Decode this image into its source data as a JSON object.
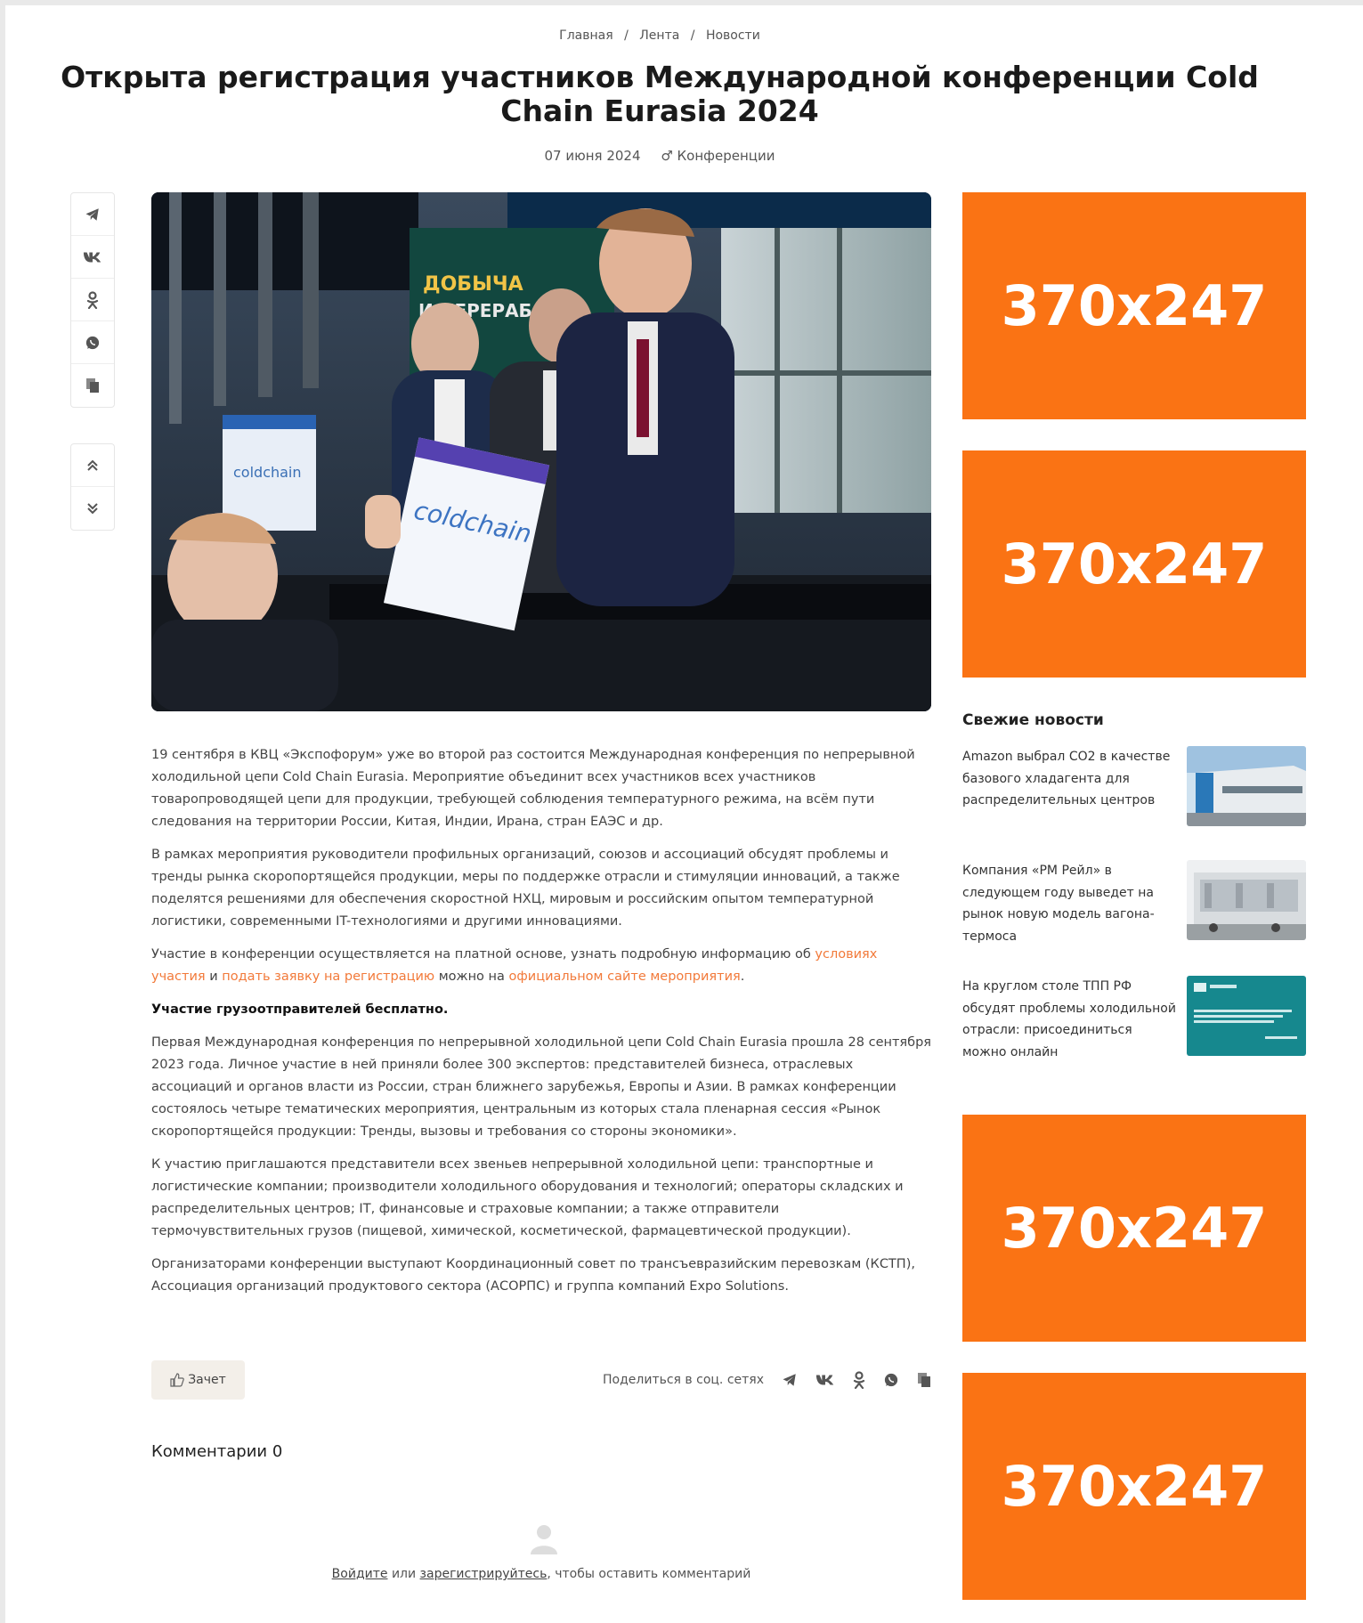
{
  "breadcrumb": {
    "home": "Главная",
    "feed": "Лента",
    "news": "Новости",
    "sep": "/"
  },
  "article": {
    "title": "Открыта регистрация участников Международной конференции Cold Chain Eurasia 2024",
    "date": "07 июня 2024",
    "category": "Конференции",
    "photo_texts": {
      "bag_label": "coldchain",
      "banner_line1": "ДОБЫЧА",
      "banner_line2": "И ПЕРЕРАБОТКА"
    },
    "p1": "19 сентября в КВЦ «Экспофорум» уже во второй раз состоится Международная конференция по непрерывной холодильной цепи Cold Chain Eurasia. Мероприятие объединит всех участников всех участников товаропроводящей цепи для продукции, требующей соблюдения температурного режима, на всём пути следования на территории России, Китая, Индии, Ирана, стран ЕАЭС и др.",
    "p2": "В рамках мероприятия руководители профильных организаций, союзов и ассоциаций обсудят проблемы и тренды рынка скоропортящейся продукции, меры по поддержке отрасли и стимуляции инноваций, а также поделятся решениями для обеспечения скоростной НХЦ, мировым и российским опытом температурной логистики, современными IT-технологиями и другими инновациями.",
    "p3_a": "Участие в конференции осуществляется на платной основе, узнать подробную информацию об ",
    "p3_link1": "условиях участия",
    "p3_b": " и ",
    "p3_link2": "подать заявку на регистрацию",
    "p3_c": " можно на ",
    "p3_link3": "официальном сайте мероприятия",
    "p3_d": ".",
    "p4_bold": "Участие грузоотправителей бесплатно.",
    "p5": "Первая Международная конференция по непрерывной холодильной цепи Cold Chain Eurasia прошла 28 сентября 2023 года. Личное участие в ней приняли более 300 экспертов: представителей бизнеса, отраслевых ассоциаций и органов власти из России, стран ближнего зарубежья, Европы и Азии. В рамках конференции состоялось четыре тематических мероприятия, центральным из которых стала пленарная сессия «Рынок скоропортящейся продукции: Тренды, вызовы и требования со стороны экономики».",
    "p6": "К участию приглашаются представители всех звеньев непрерывной холодильной цепи: транспортные и логистические компании; производители холодильного оборудования и технологий; операторы складских и распределительных центров; IT, финансовые и страховые компании; а также отправители термочувствительных грузов (пищевой, химической, косметической, фармацевтической продукции).",
    "p7": "Организаторами конференции выступают Координационный совет по трансъевразийским перевозкам (КСТП), Ассоциация организаций продуктового сектора (АСОРПС) и группа компаний Expo Solutions."
  },
  "like_label": "Зачет",
  "share_label": "Поделиться в соц. сетях",
  "comments_title": "Комментарии 0",
  "login": {
    "login_link": "Войдите",
    "or": " или ",
    "register_link": "зарегистрируйтесь",
    "rest": ", чтобы оставить комментарий"
  },
  "ads": [
    "370x247",
    "370x247",
    "370x247",
    "370x247"
  ],
  "fresh_news": {
    "title": "Свежие новости",
    "items": [
      {
        "text": "Amazon выбрал CO2 в качестве базового хладагента для распределительных центров"
      },
      {
        "text": "Компания «РМ Рейл» в следующем году выведет на рынок новую модель вагона-термоса"
      },
      {
        "text": "На круглом столе ТПП РФ обсудят проблемы холодильной отрасли: присоединиться можно онлайн"
      }
    ]
  },
  "icons": [
    "telegram-icon",
    "vk-icon",
    "odnoklassniki-icon",
    "whatsapp-icon",
    "copy-icon",
    "scroll-up-icon",
    "scroll-down-icon",
    "thumb-up-icon",
    "user-avatar-icon"
  ],
  "colors": {
    "accent": "#fa7314",
    "link": "#f27a3a"
  }
}
